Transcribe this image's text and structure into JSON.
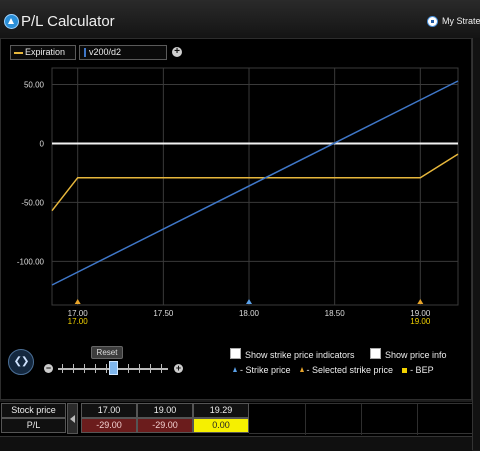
{
  "window": {
    "title": "P/L Calculator",
    "my_strategies_label": "My Strate",
    "my_strategies_icon": "strategy-icon"
  },
  "legend": {
    "expiration_label": "Expiration",
    "vol_label": "v200/d2",
    "expiration_color": "#e7b73c",
    "vol_color": "#3f77c8",
    "add_icon": "plus-icon"
  },
  "chart_data": {
    "type": "line",
    "x_ticks": [
      "17.00",
      "17.50",
      "18.00",
      "18.50",
      "19.00"
    ],
    "y_ticks": [
      "50.00",
      "0",
      "-50.00",
      "-100.00"
    ],
    "xlim": [
      16.85,
      19.22
    ],
    "ylim": [
      -137,
      64
    ],
    "zero_line": 0,
    "series": [
      {
        "name": "Expiration",
        "color": "#e7b73c",
        "x": [
          16.85,
          17.0,
          19.0,
          19.22
        ],
        "y": [
          -57,
          -29,
          -29,
          -9
        ]
      },
      {
        "name": "v200/d2",
        "color": "#3f77c8",
        "x": [
          16.85,
          19.22
        ],
        "y": [
          -120,
          53
        ]
      }
    ],
    "strike_markers": [
      {
        "x": 17.0,
        "kind": "selected",
        "label": "17.00"
      },
      {
        "x": 18.0,
        "kind": "strike",
        "label": ""
      },
      {
        "x": 19.0,
        "kind": "selected",
        "label": "19.00"
      }
    ],
    "grid": true
  },
  "controls": {
    "reset_label": "Reset",
    "show_strike_label": "Show strike price indicators",
    "show_price_info_label": "Show price info",
    "strike_price_legend": "- Strike price",
    "selected_strike_legend": "- Selected strike price",
    "bep_legend": "- BEP",
    "slider_value_pct": 46
  },
  "table": {
    "row_stock_label": "Stock price",
    "row_pl_label": "P/L",
    "columns": [
      {
        "price": "17.00",
        "pl": "-29.00",
        "kind": "loss"
      },
      {
        "price": "19.00",
        "pl": "-29.00",
        "kind": "loss"
      },
      {
        "price": "19.29",
        "pl": "0.00",
        "kind": "bep"
      }
    ]
  }
}
